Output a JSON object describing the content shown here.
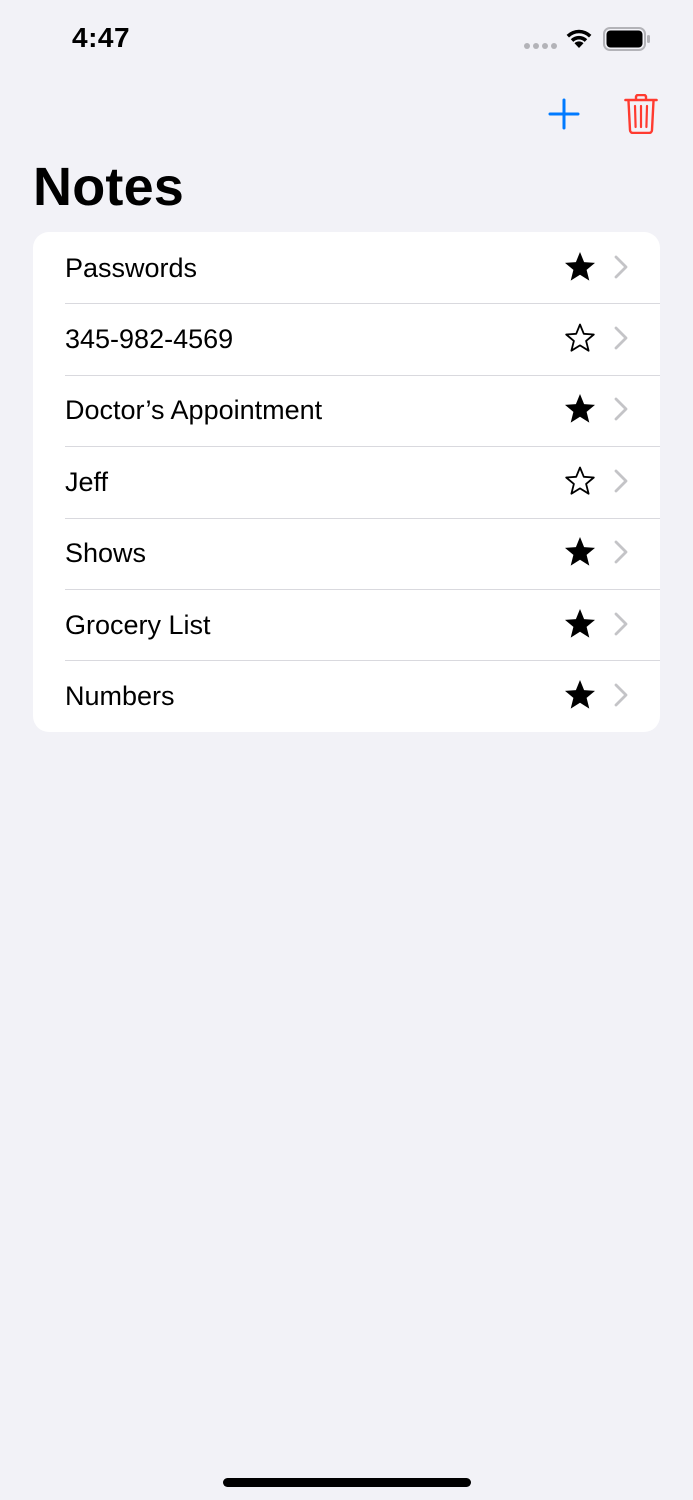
{
  "status_bar": {
    "time": "4:47"
  },
  "nav": {
    "add_icon": "plus-icon",
    "delete_icon": "trash-icon"
  },
  "page_title": "Notes",
  "notes": [
    {
      "title": "Passwords",
      "starred": true
    },
    {
      "title": "345-982-4569",
      "starred": false
    },
    {
      "title": "Doctor’s Appointment",
      "starred": true
    },
    {
      "title": "Jeff",
      "starred": false
    },
    {
      "title": "Shows",
      "starred": true
    },
    {
      "title": "Grocery List",
      "starred": true
    },
    {
      "title": "Numbers",
      "starred": true
    }
  ],
  "colors": {
    "accent": "#007aff",
    "destructive": "#ff3b30",
    "background": "#f2f2f7",
    "chevron": "#c4c4c7"
  }
}
